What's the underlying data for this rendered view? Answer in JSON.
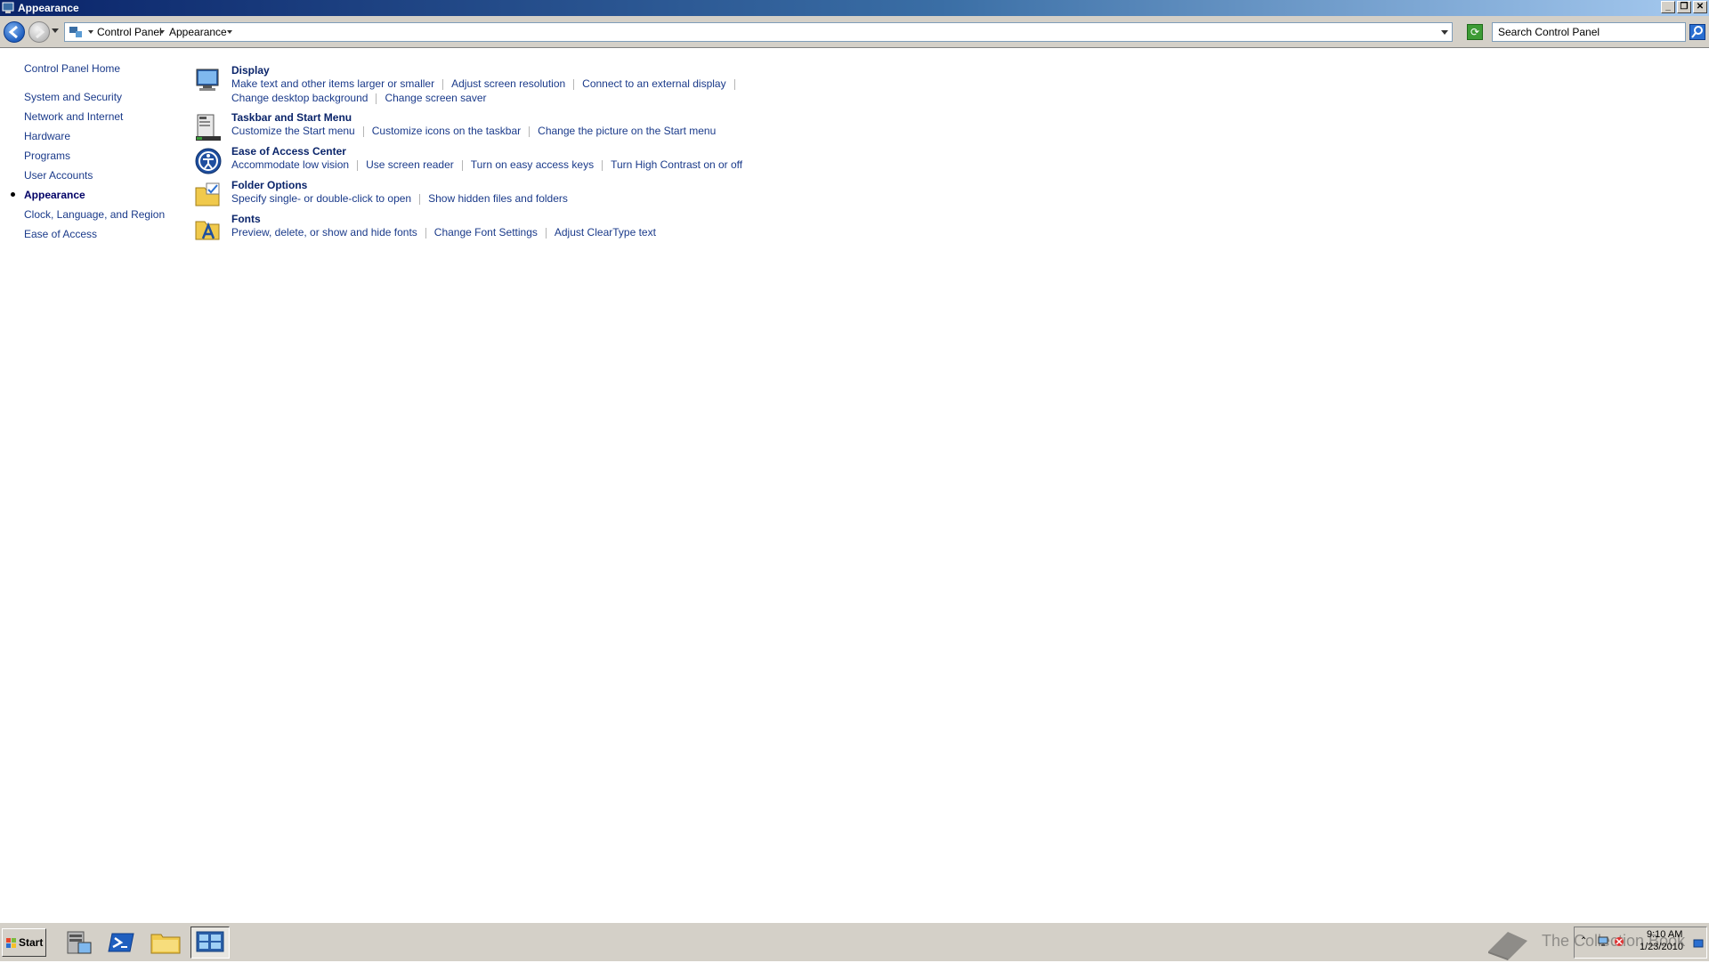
{
  "window": {
    "title": "Appearance"
  },
  "address": {
    "crumbs": [
      "Control Panel",
      "Appearance"
    ]
  },
  "search": {
    "placeholder": "Search Control Panel"
  },
  "leftnav": {
    "home": "Control Panel Home",
    "items": [
      "System and Security",
      "Network and Internet",
      "Hardware",
      "Programs",
      "User Accounts",
      "Appearance",
      "Clock, Language, and Region",
      "Ease of Access"
    ],
    "current": "Appearance"
  },
  "categories": [
    {
      "title": "Display",
      "icon": "display-icon",
      "links": [
        [
          "Make text and other items larger or smaller",
          "Adjust screen resolution",
          "Connect to an external display"
        ],
        [
          "Change desktop background",
          "Change screen saver"
        ]
      ]
    },
    {
      "title": "Taskbar and Start Menu",
      "icon": "taskbar-icon",
      "links": [
        [
          "Customize the Start menu",
          "Customize icons on the taskbar",
          "Change the picture on the Start menu"
        ]
      ]
    },
    {
      "title": "Ease of Access Center",
      "icon": "ease-of-access-icon",
      "links": [
        [
          "Accommodate low vision",
          "Use screen reader",
          "Turn on easy access keys",
          "Turn High Contrast on or off"
        ]
      ]
    },
    {
      "title": "Folder Options",
      "icon": "folder-options-icon",
      "links": [
        [
          "Specify single- or double-click to open",
          "Show hidden files and folders"
        ]
      ]
    },
    {
      "title": "Fonts",
      "icon": "fonts-icon",
      "links": [
        [
          "Preview, delete, or show and hide fonts",
          "Change Font Settings",
          "Adjust ClearType text"
        ]
      ]
    }
  ],
  "taskbar": {
    "start_label": "Start",
    "clock_time": "9:10 AM",
    "clock_date": "1/23/2010",
    "watermark": "The Collection Book"
  },
  "colors": {
    "title_bar": "#0a246a",
    "link": "#1a3a8a",
    "chrome": "#d4d0c8"
  }
}
